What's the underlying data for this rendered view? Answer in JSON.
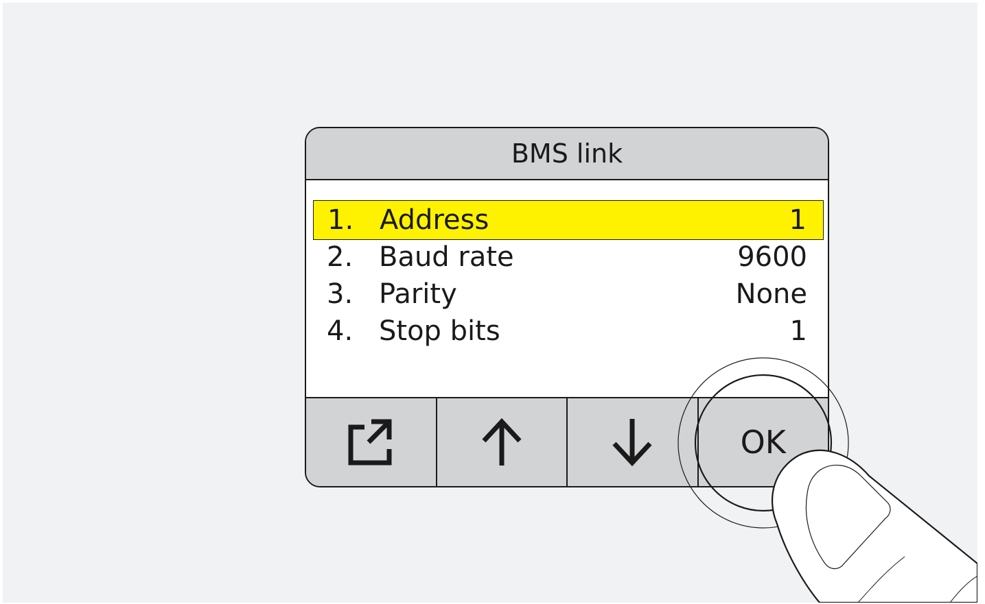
{
  "screen": {
    "title": "BMS link"
  },
  "menu": {
    "items": [
      {
        "number": "1.",
        "label": "Address",
        "value": "1",
        "selected": true
      },
      {
        "number": "2.",
        "label": "Baud rate",
        "value": "9600",
        "selected": false
      },
      {
        "number": "3.",
        "label": "Parity",
        "value": "None",
        "selected": false
      },
      {
        "number": "4.",
        "label": "Stop bits",
        "value": "1",
        "selected": false
      }
    ]
  },
  "buttons": {
    "exit_icon": "exit-icon",
    "up_icon": "arrow-up-icon",
    "down_icon": "arrow-down-icon",
    "ok_label": "OK"
  },
  "colors": {
    "highlight": "#fff200",
    "panel_gray": "#d2d3d5",
    "background": "#f1f2f4"
  }
}
